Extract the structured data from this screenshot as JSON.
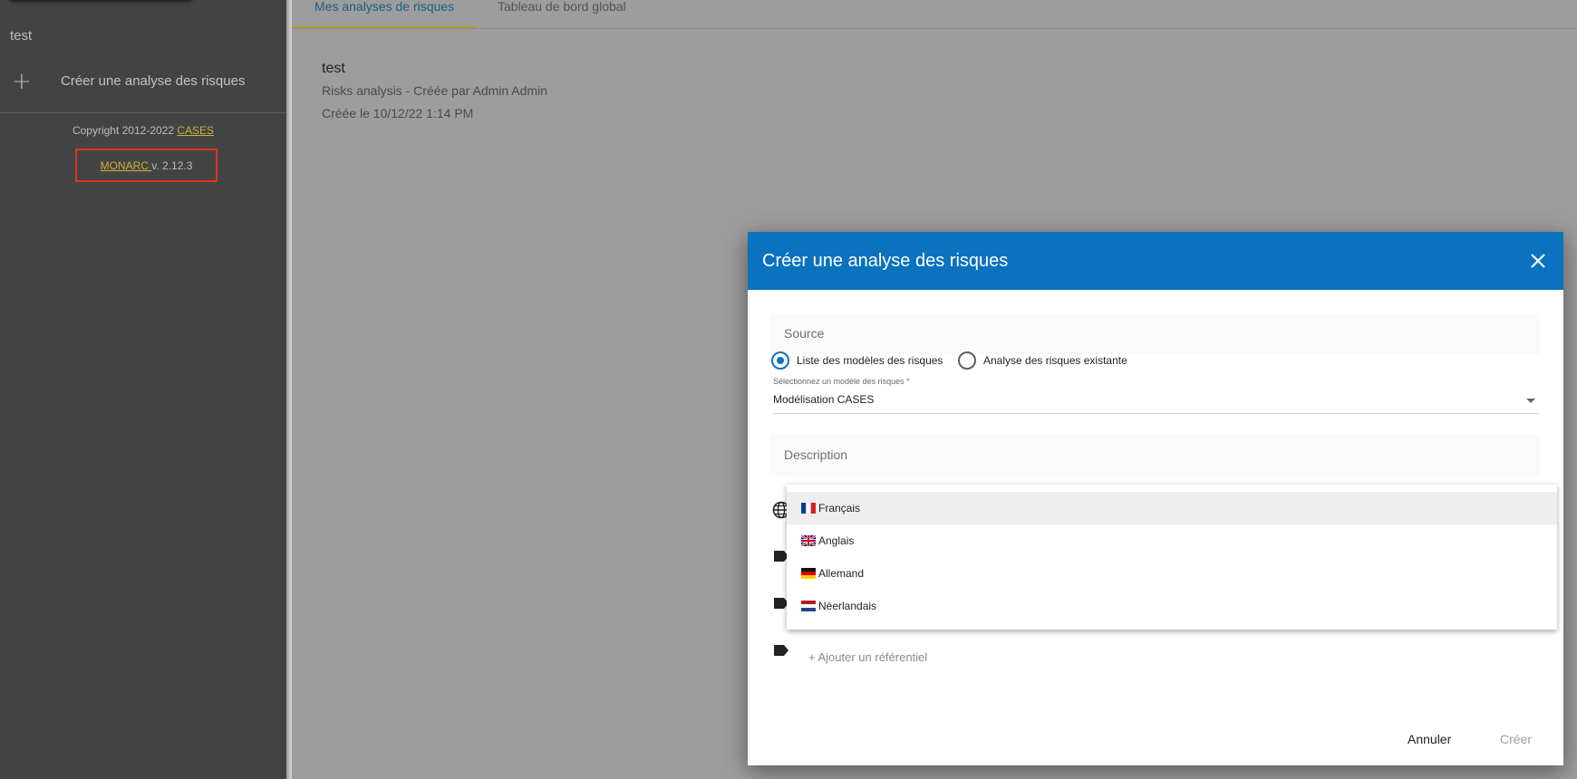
{
  "sidebar": {
    "anr_name": "test",
    "create_label": "Créer une analyse des risques",
    "copyright_prefix": "Copyright 2012-2022 ",
    "copyright_link": "CASES",
    "version_link": "MONARC ",
    "version_text": "v. 2.12.3"
  },
  "tabs": [
    {
      "label": "Mes analyses de risques",
      "active": true
    },
    {
      "label": "Tableau de bord global",
      "active": false
    }
  ],
  "analysis": {
    "name": "test",
    "subtitle": "Risks analysis - Créée par Admin Admin",
    "created": "Créée le 10/12/22 1:14 PM"
  },
  "dialog": {
    "title": "Créer une analyse des risques",
    "source_title": "Source",
    "radio_models": "Liste des modèles des risques",
    "radio_existing": "Analyse des risques existante",
    "select_label": "Sélectionnez un modèle des risques *",
    "select_value": "Modélisation CASES",
    "description_title": "Description",
    "add_referential": "+ Ajouter un référentiel",
    "cancel_label": "Annuler",
    "create_label": "Créer"
  },
  "languages": [
    {
      "label": "Français",
      "flag": "fr"
    },
    {
      "label": "Anglais",
      "flag": "gb"
    },
    {
      "label": "Allemand",
      "flag": "de"
    },
    {
      "label": "Néerlandais",
      "flag": "nl"
    }
  ],
  "colors": {
    "dialog_header": "#0a72bf",
    "sidebar_bg": "#434343",
    "link": "#c9b33b",
    "highlight_box": "#e0331f"
  }
}
